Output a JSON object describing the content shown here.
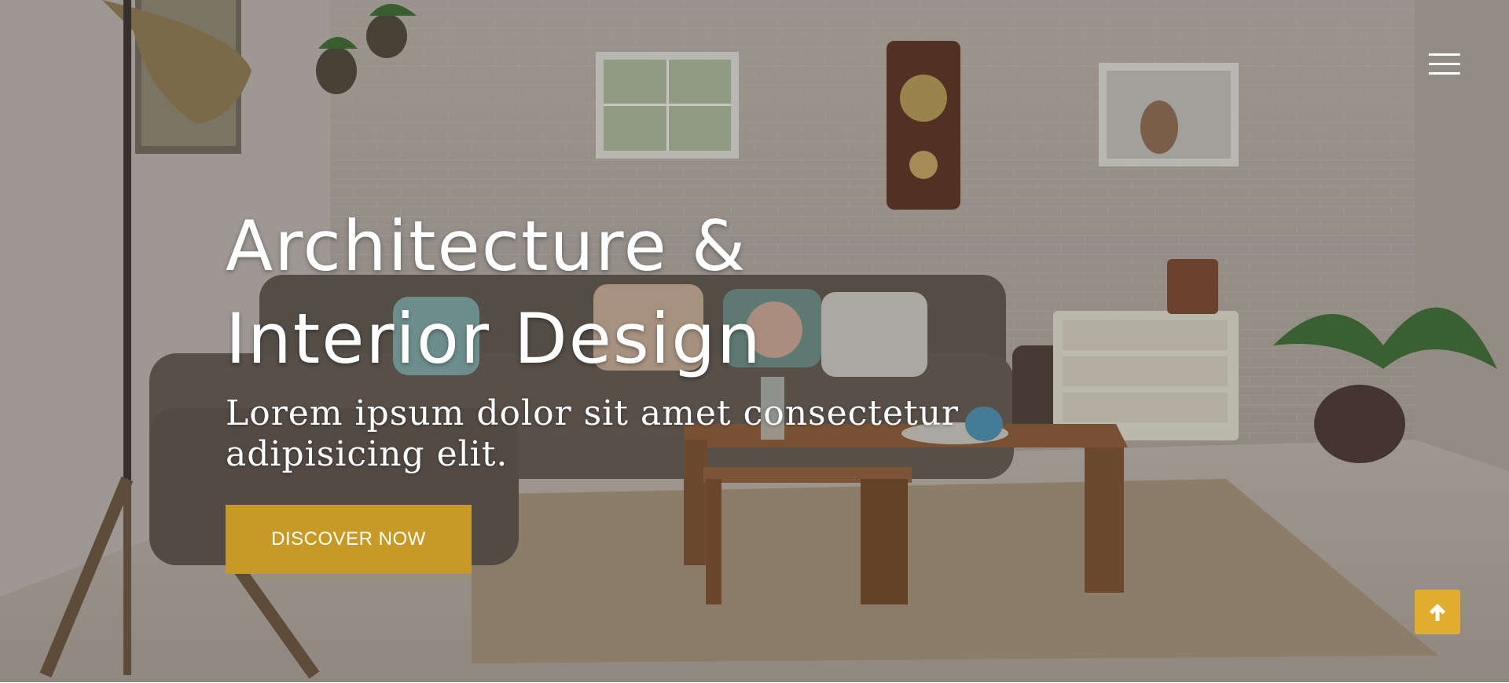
{
  "hero": {
    "title_line1": "Architecture &",
    "title_line2": "Interior Design",
    "subtitle_line1": "Lorem ipsum dolor sit amet consectetur",
    "subtitle_line2": "adipisicing elit.",
    "cta_label": "DISCOVER NOW"
  },
  "nav": {
    "menu_icon": "hamburger-menu-icon"
  },
  "scroll_top": {
    "icon": "arrow-up-icon"
  },
  "colors": {
    "accent": "#c79a27",
    "scroll_top_bg": "#e0ad2e",
    "text": "#ffffff"
  }
}
